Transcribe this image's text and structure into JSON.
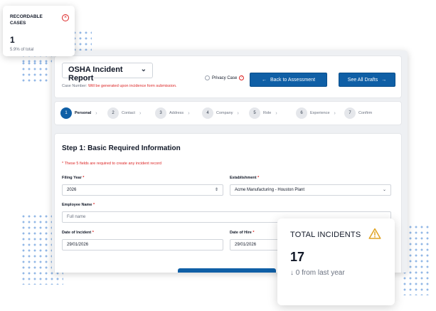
{
  "recordable": {
    "title": "RECORDABLE CASES",
    "value": "1",
    "subtitle": "5.9% of total",
    "icon": "close-circle-icon"
  },
  "header": {
    "report_select": "OSHA Incident Report",
    "case_number_label": "Case Number:",
    "case_number_value": "Will be generated upon incidence form submission.",
    "privacy_label": "Privacy Case",
    "back_label": "Back to Assessment",
    "drafts_label": "See All Drafts",
    "accent": "#0f5fa6"
  },
  "steps": [
    {
      "num": "1",
      "label": "Personal",
      "active": true
    },
    {
      "num": "2",
      "label": "Contact"
    },
    {
      "num": "3",
      "label": "Address"
    },
    {
      "num": "4",
      "label": "Company"
    },
    {
      "num": "5",
      "label": "Role"
    },
    {
      "num": "6",
      "label": "Experience"
    },
    {
      "num": "7",
      "label": "Confirm"
    }
  ],
  "form": {
    "title": "Step 1: Basic Required Information",
    "required_note": "* These 5 fields are required to create any incident record",
    "filing_year_label": "Filing Year",
    "filing_year_value": "2026",
    "establishment_label": "Establishment",
    "establishment_value": "Acme Manufacturing - Houston Plant",
    "employee_name_label": "Employee Name",
    "employee_name_placeholder": "Full name",
    "date_incident_label": "Date of Incident",
    "date_incident_value": "29/01/2026",
    "date_hire_label": "Date of Hire",
    "date_hire_value": "29/01/2026",
    "required_mark": "*"
  },
  "total": {
    "title": "TOTAL INCIDENTS",
    "value": "17",
    "subtitle": "↓ 0 from last year",
    "icon": "warning-icon"
  }
}
